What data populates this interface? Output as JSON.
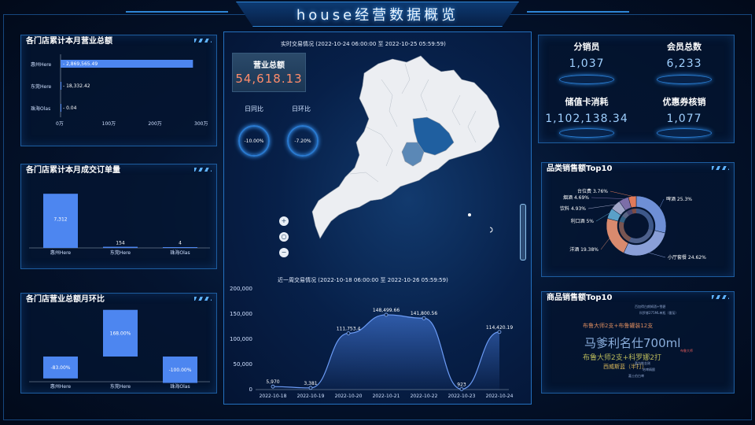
{
  "header": {
    "title": "house经营数据概览"
  },
  "panel_revenue": {
    "title": "各门店累计本月营业总额",
    "chart_data": {
      "type": "bar",
      "orientation": "horizontal",
      "categories": [
        "惠州Here",
        "东莞Here",
        "珠海Olas"
      ],
      "values": [
        2869565.49,
        18332.42,
        0.04
      ],
      "value_labels": [
        "2,869,565.49",
        "18,332.42",
        "0.04"
      ],
      "x_ticks": [
        "0万",
        "100万",
        "200万",
        "300万"
      ],
      "xlim": [
        0,
        3000000
      ]
    }
  },
  "panel_orders": {
    "title": "各门店累计本月成交订单量",
    "chart_data": {
      "type": "bar",
      "categories": [
        "惠州Here",
        "东莞Here",
        "珠海Olas"
      ],
      "values": [
        7312,
        154,
        4
      ],
      "value_labels": [
        "7,312",
        "154",
        "4"
      ],
      "ylim": [
        0,
        8500
      ]
    }
  },
  "panel_mom": {
    "title": "各门店营业总额月环比",
    "chart_data": {
      "type": "bar",
      "categories": [
        "惠州Here",
        "东莞Here",
        "珠海Olas"
      ],
      "values": [
        -83.0,
        168.0,
        -100.0
      ],
      "value_labels": [
        "-83.00%",
        "168.00%",
        "-100.00%"
      ]
    }
  },
  "center": {
    "map_caption": "实时交易情况 (2022-10-24 06:00:00 至 2022-10-25 05:59:59)",
    "total_label": "营业总额",
    "total_value": "54,618.13",
    "day_ratio_label": "日同比",
    "day_ratio_value": "-10.00%",
    "chain_ratio_label": "日环比",
    "chain_ratio_value": "-7.20%",
    "zoom_in": "+",
    "zoom_reset": "○",
    "zoom_out": "−",
    "week_caption": "近一周交易情况 (2022-10-18 06:00:00 至 2022-10-26 05:59:59)",
    "chart_data": {
      "type": "area",
      "x": [
        "2022-10-18",
        "2022-10-19",
        "2022-10-20",
        "2022-10-21",
        "2022-10-22",
        "2022-10-23",
        "2022-10-24"
      ],
      "values": [
        5970,
        3381,
        111753.4,
        148499.66,
        141800.56,
        923,
        114420.19
      ],
      "value_labels": [
        "5,970",
        "3,381",
        "111,753.4",
        "148,499.66",
        "141,800.56",
        "923",
        "114,420.19"
      ],
      "y_ticks": [
        "0",
        "50,000",
        "100,000",
        "150,000",
        "200,000"
      ],
      "ylim": [
        0,
        200000
      ]
    }
  },
  "stats": {
    "sales_label": "分销员",
    "sales_value": "1,037",
    "members_label": "会员总数",
    "members_value": "6,233",
    "card_label": "储值卡消耗",
    "card_value": "1,102,138.34",
    "coupon_label": "优惠券核销",
    "coupon_value": "1,077"
  },
  "panel_category": {
    "title": "品类销售额Top10",
    "chart_data": {
      "type": "pie",
      "style": "nested-donut",
      "slices": [
        {
          "name": "啤酒",
          "value": 25.3,
          "label": "啤酒 25.3%",
          "color": "#6e8fd6"
        },
        {
          "name": "小厅套餐",
          "value": 24.62,
          "label": "小厅套餐 24.62%",
          "color": "#8a9fd8"
        },
        {
          "name": "洋酒",
          "value": 19.38,
          "label": "洋酒 19.38%",
          "color": "#d98a6e"
        },
        {
          "name": "利口酒",
          "value": 5,
          "label": "利口酒 5%",
          "color": "#5aa0c8"
        },
        {
          "name": "饮料",
          "value": 4.93,
          "label": "饮料 4.93%",
          "color": "#a0a6c8"
        },
        {
          "name": "烟酒",
          "value": 4.69,
          "label": "烟酒 4.69%",
          "color": "#7c6ea8"
        },
        {
          "name": "台位费",
          "value": 3.76,
          "label": "台位费 3.76%",
          "color": "#e07a5a"
        }
      ]
    }
  },
  "panel_product": {
    "title": "商品销售额Top10",
    "words": [
      {
        "text": "马爹利名仕700ml",
        "color": "#8aaedc",
        "size": 15
      },
      {
        "text": "布鲁大师2支+布鲁罐装12支",
        "color": "#d98a5e",
        "size": 7
      },
      {
        "text": "布鲁大师2支+科罗娜2打",
        "color": "#b8b85a",
        "size": 9
      },
      {
        "text": "西威斯蓝（半打）",
        "color": "#d6b45a",
        "size": 7
      },
      {
        "text": "布鲁大师",
        "color": "#e05a5a",
        "size": 4
      },
      {
        "text": "科罗娜275ML单瓶（番茄）",
        "color": "#8aa0c8",
        "size": 4
      },
      {
        "text": "百加得白朗姆酒+雪碧",
        "color": "#8aa0c8",
        "size": 4
      },
      {
        "text": "喜力铁金刚",
        "color": "#8aa0c8",
        "size": 4
      },
      {
        "text": "哈啤精酿",
        "color": "#8aa0c8",
        "size": 4
      },
      {
        "text": "嘉士伯白啤",
        "color": "#8aa0c8",
        "size": 4
      }
    ]
  }
}
